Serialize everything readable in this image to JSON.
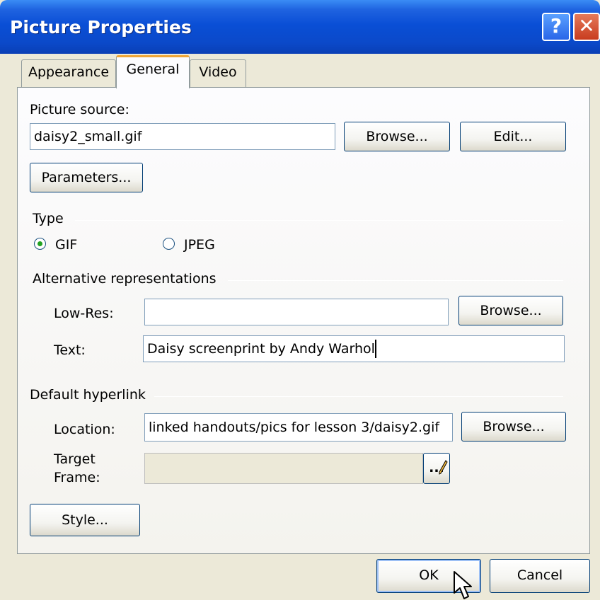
{
  "window": {
    "title": "Picture Properties",
    "help_label": "?",
    "close_label": "✕"
  },
  "tabs": [
    {
      "label": "Appearance",
      "active": false
    },
    {
      "label": "General",
      "active": true
    },
    {
      "label": "Video",
      "active": false
    }
  ],
  "picture_source": {
    "label": "Picture source:",
    "value": "daisy2_small.gif",
    "browse_label": "Browse...",
    "edit_label": "Edit...",
    "parameters_label": "Parameters..."
  },
  "type": {
    "label": "Type",
    "options": [
      {
        "label": "GIF",
        "checked": true
      },
      {
        "label": "JPEG",
        "checked": false
      }
    ]
  },
  "alternative": {
    "label": "Alternative representations",
    "lowres_label": "Low-Res:",
    "lowres_value": "",
    "browse_label": "Browse...",
    "text_label": "Text:",
    "text_value": "Daisy screenprint by Andy Warhol"
  },
  "hyperlink": {
    "label": "Default hyperlink",
    "location_label": "Location:",
    "location_value": "linked handouts/pics for lesson 3/daisy2.gif",
    "browse_label": "Browse...",
    "target_label_1": "Target",
    "target_label_2": "Frame:",
    "target_value": "",
    "target_button_label": "...",
    "style_label": "Style..."
  },
  "footer": {
    "ok_label": "OK",
    "cancel_label": "Cancel"
  },
  "colors": {
    "titlebar": "#0a4fd6",
    "dialog_bg": "#ece9d8",
    "tab_accent": "#f0a535"
  }
}
